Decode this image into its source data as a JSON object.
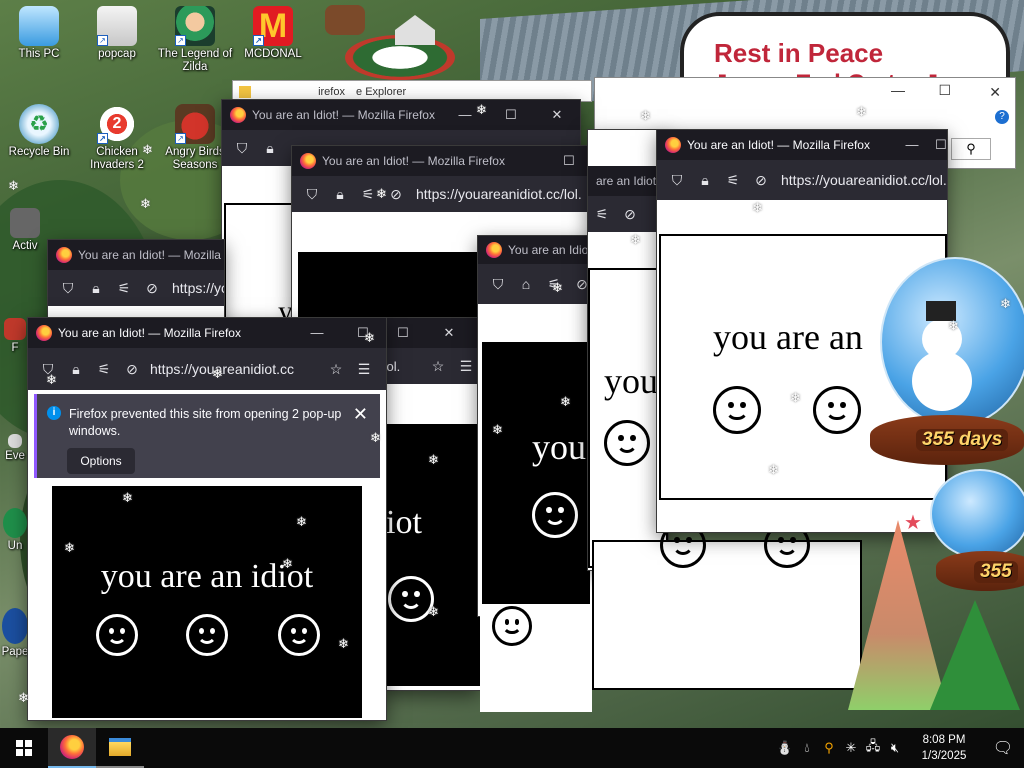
{
  "desktop": {
    "icons": [
      {
        "label": "This PC"
      },
      {
        "label": "popcap"
      },
      {
        "label": "The Legend of Zilda"
      },
      {
        "label": "MCDONAL"
      },
      {
        "label": "Recycle Bin"
      },
      {
        "label": "Chicken Invaders 2"
      },
      {
        "label": "Angry Birds Seasons"
      },
      {
        "label": "Activ"
      },
      {
        "label": "F"
      },
      {
        "label": "Eve"
      },
      {
        "label": "Un"
      },
      {
        "label": "Pape"
      }
    ],
    "poster": {
      "title": "Rest in Peace",
      "subtitle": "James Earl Carter Jr"
    },
    "globe": {
      "days_top": "355 days",
      "days_bottom": "355"
    },
    "badge_number": "2"
  },
  "explorer": {
    "title_partial": "e Explorer",
    "title_partial2": "irefox"
  },
  "windows": {
    "title": "You are an Idiot! — Mozilla Firefox",
    "title_short": "You are an Idiot! — Mozilla Firefox",
    "title_cut": "are an Idiot",
    "title_cut2": "You are an Idio",
    "url": "https://youareanidiot.cc/lol.",
    "url_short": "https://youareanidiot.cc",
    "url_frag": "https://yo",
    "url_frag2": "/lol.",
    "idiot_text": "you are an idiot",
    "text_you": "you",
    "text_you_are_an": "you are an",
    "text_iot": "iot",
    "text_y": "y"
  },
  "notification": {
    "message": "Firefox prevented this site from opening 2 pop-up windows.",
    "options_label": "Options"
  },
  "taskbar": {
    "apps": [
      "firefox-icon",
      "file-explorer-icon"
    ],
    "time": "8:08 PM",
    "date": "1/3/2025"
  }
}
